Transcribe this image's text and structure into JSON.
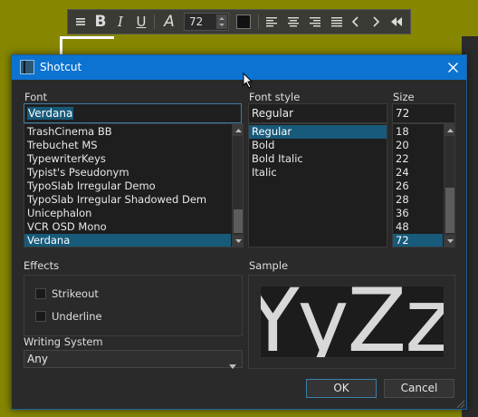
{
  "toolbar": {
    "font_size_value": "72",
    "buttons": [
      "menu",
      "bold",
      "italic",
      "underline",
      "font",
      "color",
      "align-left",
      "align-center",
      "align-right",
      "justify",
      "prev",
      "next",
      "rewind"
    ],
    "bold_glyph": "B",
    "italic_glyph": "I",
    "underline_glyph": "U",
    "font_glyph": "A"
  },
  "dialog": {
    "title": "Shotcut",
    "font": {
      "label": "Font",
      "value": "Verdana",
      "items": [
        "TrashCinema BB",
        "Trebuchet MS",
        "TypewriterKeys",
        "Typist's Pseudonym",
        "TypoSlab Irregular Demo",
        "TypoSlab Irregular Shadowed Dem",
        "Unicephalon",
        "VCR OSD Mono",
        "Verdana"
      ],
      "selected": "Verdana"
    },
    "font_style": {
      "label": "Font style",
      "value": "Regular",
      "items": [
        "Regular",
        "Bold",
        "Bold Italic",
        "Italic"
      ],
      "selected": "Regular"
    },
    "size": {
      "label": "Size",
      "value": "72",
      "items": [
        "18",
        "20",
        "22",
        "24",
        "26",
        "28",
        "36",
        "48",
        "72"
      ],
      "selected": "72"
    },
    "effects": {
      "label": "Effects",
      "strikeout": "Strikeout",
      "strikeout_checked": false,
      "underline": "Underline",
      "underline_checked": false
    },
    "writing_system": {
      "label": "Writing System",
      "value": "Any"
    },
    "sample": {
      "label": "Sample",
      "text": "YyZz"
    },
    "buttons": {
      "ok": "OK",
      "cancel": "Cancel"
    }
  },
  "colors": {
    "titlebar": "#0d73d1",
    "selection": "#175a7a",
    "background": "#868600"
  }
}
